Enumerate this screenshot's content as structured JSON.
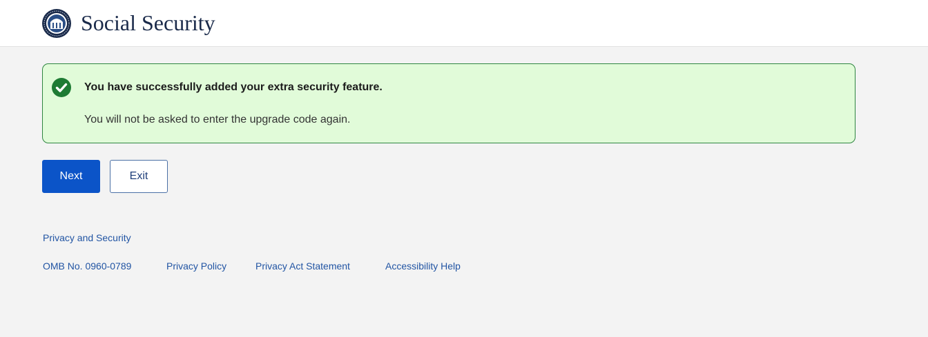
{
  "header": {
    "brand": "Social Security",
    "logo_icon": "ssa-seal-icon"
  },
  "alert": {
    "icon": "check-circle-icon",
    "title": "You have successfully added your extra security feature.",
    "body": "You will not be asked to enter the upgrade code again.",
    "colors": {
      "background": "#e1fbd9",
      "border": "#2e8540",
      "icon": "#1e7b34"
    }
  },
  "actions": {
    "next_label": "Next",
    "exit_label": "Exit"
  },
  "footer": {
    "privacy_security": "Privacy and Security",
    "omb_number": "OMB No. 0960-0789",
    "privacy_policy": "Privacy Policy",
    "privacy_act": "Privacy Act Statement",
    "accessibility": "Accessibility Help"
  },
  "colors": {
    "primary_button": "#0b54c8",
    "link": "#2154a3",
    "page_background": "#f3f3f3"
  }
}
